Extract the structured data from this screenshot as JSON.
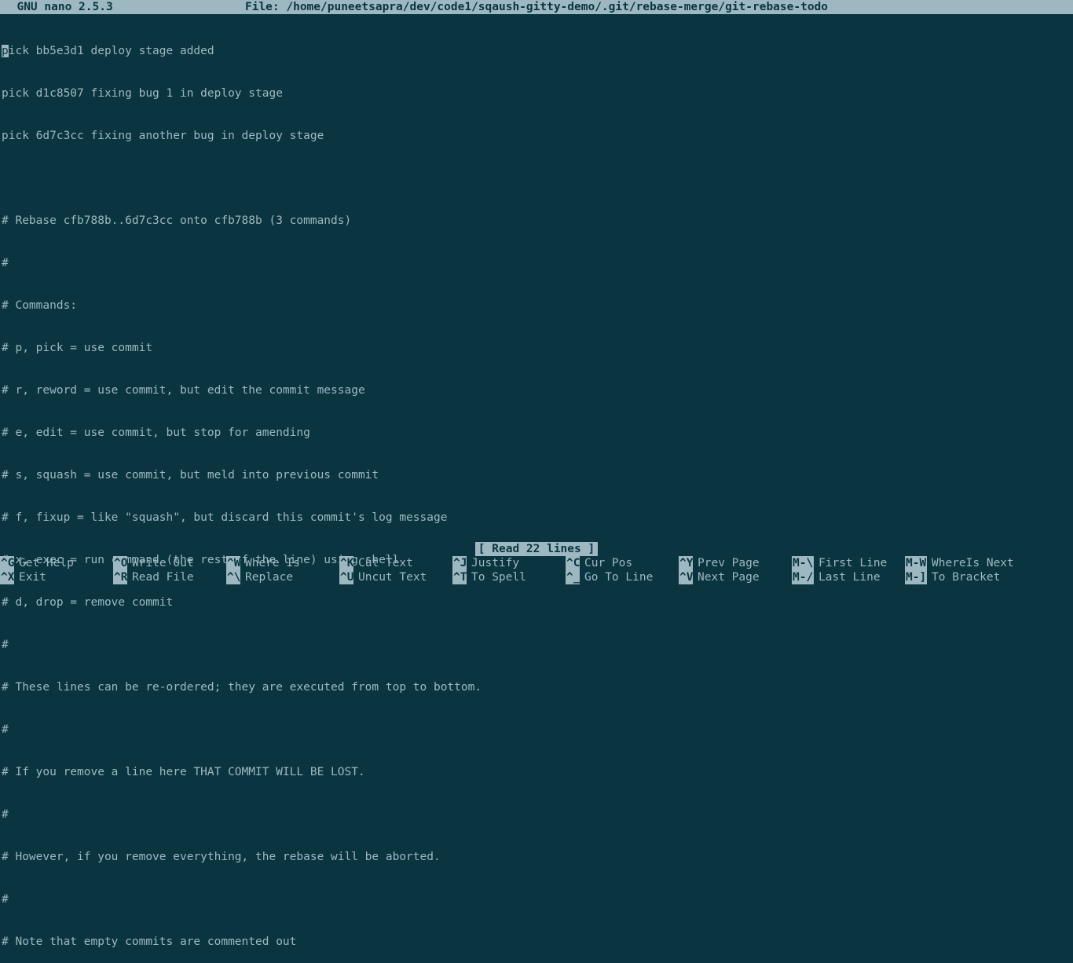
{
  "title_bar": {
    "app_name": "  GNU nano 2.5.3",
    "file_label": "File: /home/puneetsapra/dev/code1/sqaush-gitty-demo/.git/rebase-merge/git-rebase-todo"
  },
  "buffer": {
    "cursor_char": "p",
    "line0_rest": "ick bb5e3d1 deploy stage added",
    "line1": "pick d1c8507 fixing bug 1 in deploy stage",
    "line2": "pick 6d7c3cc fixing another bug in deploy stage",
    "line3": "",
    "line4": "# Rebase cfb788b..6d7c3cc onto cfb788b (3 commands)",
    "line5": "#",
    "line6": "# Commands:",
    "line7": "# p, pick = use commit",
    "line8": "# r, reword = use commit, but edit the commit message",
    "line9": "# e, edit = use commit, but stop for amending",
    "line10": "# s, squash = use commit, but meld into previous commit",
    "line11": "# f, fixup = like \"squash\", but discard this commit's log message",
    "line12": "# x, exec = run command (the rest of the line) using shell",
    "line13": "# d, drop = remove commit",
    "line14": "#",
    "line15": "# These lines can be re-ordered; they are executed from top to bottom.",
    "line16": "#",
    "line17": "# If you remove a line here THAT COMMIT WILL BE LOST.",
    "line18": "#",
    "line19": "# However, if you remove everything, the rebase will be aborted.",
    "line20": "#",
    "line21": "# Note that empty commits are commented out"
  },
  "status": {
    "message": "[ Read 22 lines ]"
  },
  "shortcuts": {
    "row1": [
      {
        "key": "^G",
        "label": "Get Help"
      },
      {
        "key": "^O",
        "label": "Write Out"
      },
      {
        "key": "^W",
        "label": "Where Is"
      },
      {
        "key": "^K",
        "label": "Cut Text"
      },
      {
        "key": "^J",
        "label": "Justify"
      },
      {
        "key": "^C",
        "label": "Cur Pos"
      },
      {
        "key": "^Y",
        "label": "Prev Page"
      },
      {
        "key": "M-\\",
        "label": "First Line"
      },
      {
        "key": "M-W",
        "label": "WhereIs Next"
      }
    ],
    "row2": [
      {
        "key": "^X",
        "label": "Exit"
      },
      {
        "key": "^R",
        "label": "Read File"
      },
      {
        "key": "^\\",
        "label": "Replace"
      },
      {
        "key": "^U",
        "label": "Uncut Text"
      },
      {
        "key": "^T",
        "label": "To Spell"
      },
      {
        "key": "^_",
        "label": "Go To Line"
      },
      {
        "key": "^V",
        "label": "Next Page"
      },
      {
        "key": "M-/",
        "label": "Last Line"
      },
      {
        "key": "M-]",
        "label": "To Bracket"
      }
    ]
  },
  "shortcut_widths": [
    144,
    144,
    144,
    144,
    144,
    144,
    144,
    144,
    170
  ]
}
